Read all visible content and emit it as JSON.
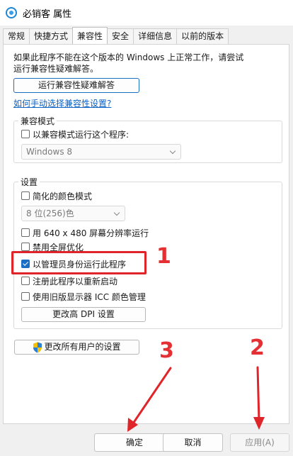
{
  "window": {
    "title": "必销客 属性"
  },
  "tabs": [
    {
      "label": "常规"
    },
    {
      "label": "快捷方式"
    },
    {
      "label": "兼容性"
    },
    {
      "label": "安全"
    },
    {
      "label": "详细信息"
    },
    {
      "label": "以前的版本"
    }
  ],
  "active_tab": "兼容性",
  "intro": {
    "line1": "如果此程序不能在这个版本的 Windows 上正常工作，请尝试",
    "line2": "运行兼容性疑难解答。"
  },
  "troubleshoot_button": "运行兼容性疑难解答",
  "manual_link": "如何手动选择兼容性设置?",
  "compat_mode": {
    "group_label": "兼容模式",
    "checkbox_label": "以兼容模式运行这个程序:",
    "checked": false,
    "select_value": "Windows 8"
  },
  "settings": {
    "group_label": "设置",
    "reduced_color": {
      "label": "简化的颜色模式",
      "checked": false
    },
    "color_select_value": "8 位(256)色",
    "resolution_640": {
      "label": "用 640 x 480 屏幕分辨率运行",
      "checked": false
    },
    "disable_fullscreen": {
      "label": "禁用全屏优化",
      "checked": false
    },
    "run_as_admin": {
      "label": "以管理员身份运行此程序",
      "checked": true
    },
    "register_restart": {
      "label": "注册此程序以重新启动",
      "checked": false
    },
    "legacy_icc": {
      "label": "使用旧版显示器 ICC 颜色管理",
      "checked": false
    },
    "dpi_button": "更改高 DPI 设置"
  },
  "all_users_button": "更改所有用户的设置",
  "footer": {
    "ok": "确定",
    "cancel": "取消",
    "apply": "应用(A)"
  },
  "annotations": {
    "step1": "1",
    "step2": "2",
    "step3": "3"
  },
  "colors": {
    "accent": "#1a6fc4",
    "annotation_red": "#e0252a"
  }
}
